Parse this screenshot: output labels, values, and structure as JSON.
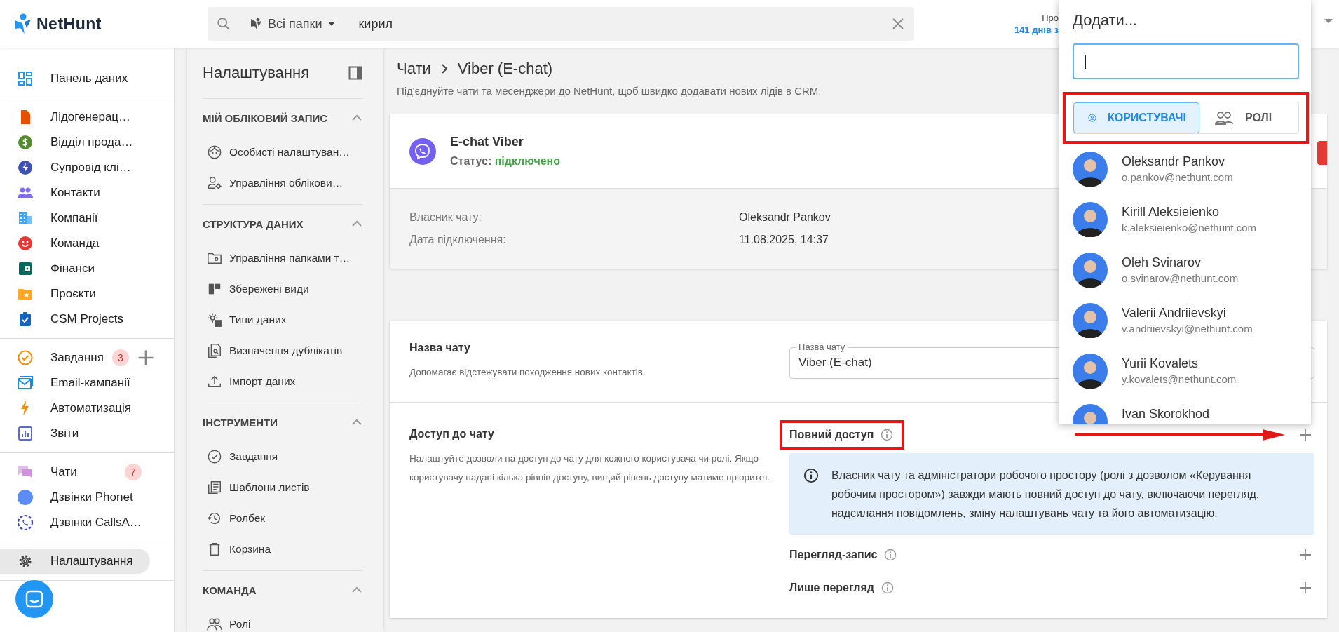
{
  "topbar": {
    "logo": "NetHunt",
    "search": {
      "scope": "Всі папки",
      "value": "кирил"
    },
    "account": {
      "line_1": "Про",
      "line_2": "141 днів з"
    }
  },
  "nav": {
    "groups": [
      {
        "items": [
          {
            "label": "Панель даних",
            "selected": false
          }
        ]
      },
      {
        "items": [
          {
            "label": "Лідогенерац…",
            "selected": false
          },
          {
            "label": "Відділ прода…",
            "selected": false
          },
          {
            "label": "Супровід клі…",
            "selected": false
          },
          {
            "label": "Контакти",
            "selected": false
          },
          {
            "label": "Компанії",
            "selected": false
          },
          {
            "label": "Команда",
            "selected": false
          },
          {
            "label": "Фінанси",
            "selected": false
          },
          {
            "label": "Проєкти",
            "selected": false
          },
          {
            "label": "CSM Projects",
            "selected": false
          }
        ]
      },
      {
        "items": [
          {
            "label": "Завдання",
            "selected": false,
            "badge": "3",
            "add": true
          },
          {
            "label": "Email-кампанії",
            "selected": false
          },
          {
            "label": "Автоматизація",
            "selected": false
          },
          {
            "label": "Звіти",
            "selected": false
          }
        ]
      },
      {
        "items": [
          {
            "label": "Чати",
            "selected": false,
            "badge": "7"
          },
          {
            "label": "Дзвінки Phonet",
            "selected": false
          },
          {
            "label": "Дзвінки CallsA…",
            "selected": false
          }
        ]
      },
      {
        "items": [
          {
            "label": "Налаштування",
            "selected": true
          }
        ]
      }
    ]
  },
  "settings": {
    "title": "Налаштування",
    "sections": [
      {
        "title": "МІЙ ОБЛІКОВИЙ ЗАПИС",
        "expanded": true,
        "items": [
          "Особисті налаштуван…",
          "Управління облікови…"
        ]
      },
      {
        "title": "СТРУКТУРА ДАНИХ",
        "expanded": true,
        "items": [
          "Управління папками т…",
          "Збережені види",
          "Типи даних",
          "Визначення дублікатів",
          "Імпорт даних"
        ]
      },
      {
        "title": "ІНСТРУМЕНТИ",
        "expanded": true,
        "items": [
          "Завдання",
          "Шаблони листів",
          "Ролбек",
          "Корзина"
        ]
      },
      {
        "title": "КОМАНДА",
        "expanded": true,
        "items": [
          "Ролі"
        ]
      }
    ]
  },
  "breadcrumb": [
    "Чати",
    "Viber (E-chat)"
  ],
  "subtitle": "Під'єднуйте чати та месенджери до NetHunt, щоб швидко додавати нових лідів в CRM.",
  "chat_card": {
    "name": "E-chat Viber",
    "status": {
      "label": "Статус:",
      "value": "підключено",
      "connected": true
    },
    "details": [
      {
        "label": "Власник чату:",
        "value": "Oleksandr Pankov"
      },
      {
        "label": "Дата підключення:",
        "value": "11.08.2025, 14:37"
      }
    ]
  },
  "settings_card": {
    "chat_name": {
      "title": "Назва чату",
      "description": "Допомагає відстежувати походження нових контактів.",
      "field_label": "Назва чату",
      "value": "Viber (E-chat)"
    },
    "access": {
      "title": "Доступ до чату",
      "description": "Налаштуйте дозволи на доступ до чату для кожного користувача чи ролі. Якщо користувачу надані кілька рівнів доступу, вищий рівень доступу матиме пріоритет.",
      "levels": [
        {
          "label": "Повний доступ",
          "highlighted": true,
          "arrow": true,
          "note": "Власник чату та адміністратори робочого простору (ролі з дозволом «Керування робочим простором») завжди мають повний доступ до чату, включаючи перегляд, надсилання повідомлень, зміну налаштувань чату та його автоматизацію."
        },
        {
          "label": "Перегляд-запис",
          "highlighted": false,
          "arrow": false
        },
        {
          "label": "Лише перегляд",
          "highlighted": false,
          "arrow": false
        }
      ]
    }
  },
  "add_popup": {
    "title": "Додати...",
    "tabs_highlighted": true,
    "tabs": [
      {
        "label": "КОРИСТУВАЧІ",
        "selected": true
      },
      {
        "label": "РОЛІ",
        "selected": false
      }
    ],
    "users": [
      {
        "name": "Oleksandr Pankov",
        "email": "o.pankov@nethunt.com"
      },
      {
        "name": "Kirill Aleksieienko",
        "email": "k.aleksieienko@nethunt.com"
      },
      {
        "name": "Oleh Svinarov",
        "email": "o.svinarov@nethunt.com"
      },
      {
        "name": "Valerii Andriievskyi",
        "email": "v.andriievskyi@nethunt.com"
      },
      {
        "name": "Yurii Kovalets",
        "email": "y.kovalets@nethunt.com"
      },
      {
        "name": "Ivan Skorokhod"
      }
    ]
  }
}
